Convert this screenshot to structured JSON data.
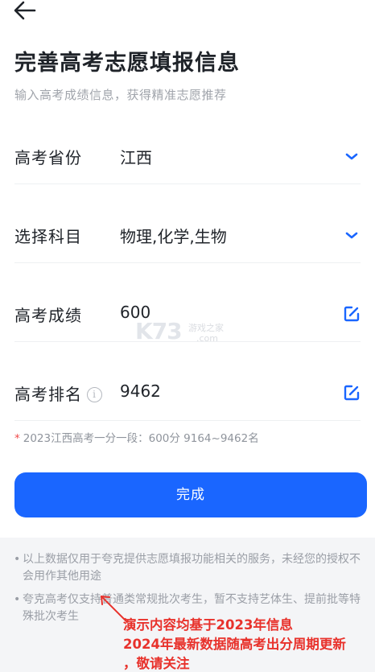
{
  "header": {
    "back_icon": "arrow-left-icon",
    "title": "完善高考志愿填报信息",
    "subtitle": "输入高考成绩信息，获得精准志愿推荐"
  },
  "form": {
    "province": {
      "label": "高考省份",
      "value": "江西",
      "icon": "chevron-down-icon"
    },
    "subjects": {
      "label": "选择科目",
      "value": "物理,化学,生物",
      "icon": "chevron-down-icon"
    },
    "score": {
      "label": "高考成绩",
      "value": "600",
      "icon": "edit-icon"
    },
    "rank": {
      "label": "高考排名",
      "info_glyph": "i",
      "value": "9462",
      "icon": "edit-icon"
    }
  },
  "hint": {
    "star": "*",
    "text": "2023江西高考一分一段：600分 9164~9462名"
  },
  "done_button": "完成",
  "notes": [
    {
      "bullet": "•",
      "text": "以上数据仅用于夸克提供志愿填报功能相关的服务，未经您的授权不会用作其他用途"
    },
    {
      "bullet": "•",
      "text": "夸克高考仅支持普通类常规批次考生，暂不支持艺体生、提前批等特殊批次考生"
    }
  ],
  "overlay": {
    "line1": "演示内容均基于2023年信息",
    "line2": "2024年最新数据随高考出分周期更新",
    "line3": "，敬请关注"
  },
  "watermark": {
    "brand": "K73",
    "cn": "游戏之家",
    "com": ".com"
  },
  "colors": {
    "accent": "#1a66ff",
    "warning_red": "#e8322c",
    "hint_star": "#f04a4a"
  }
}
